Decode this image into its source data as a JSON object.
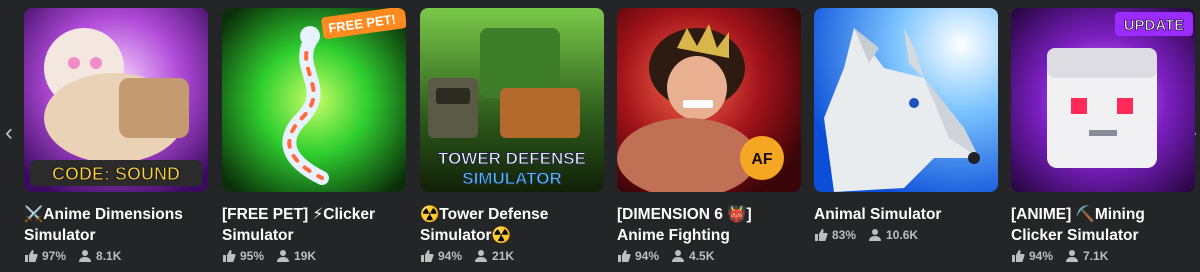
{
  "games": [
    {
      "title_line1": "⚔️Anime Dimensions",
      "title_line2": "Simulator",
      "rating": "97%",
      "players": "8.1K",
      "thumb_text": "CODE: SOUND",
      "badge": ""
    },
    {
      "title_line1": "[FREE PET] ⚡Clicker",
      "title_line2": "Simulator",
      "rating": "95%",
      "players": "19K",
      "thumb_text": "",
      "badge": "FREE PET!"
    },
    {
      "title_line1": "☢️Tower Defense",
      "title_line2": "Simulator☢️",
      "rating": "94%",
      "players": "21K",
      "thumb_text": "TOWER DEFENSE",
      "thumb_text2": "SIMULATOR",
      "badge": ""
    },
    {
      "title_line1": "[DIMENSION 6 👹]",
      "title_line2": "Anime Fighting",
      "rating": "94%",
      "players": "4.5K",
      "thumb_text": "",
      "badge": ""
    },
    {
      "title_line1": "Animal Simulator",
      "title_line2": "",
      "rating": "83%",
      "players": "10.6K",
      "thumb_text": "",
      "badge": ""
    },
    {
      "title_line1": "[ANIME] ⛏️Mining",
      "title_line2": "Clicker Simulator",
      "rating": "94%",
      "players": "7.1K",
      "thumb_text": "",
      "badge": "UPDATE"
    }
  ],
  "nav": {
    "prev": "‹",
    "next": "›"
  }
}
